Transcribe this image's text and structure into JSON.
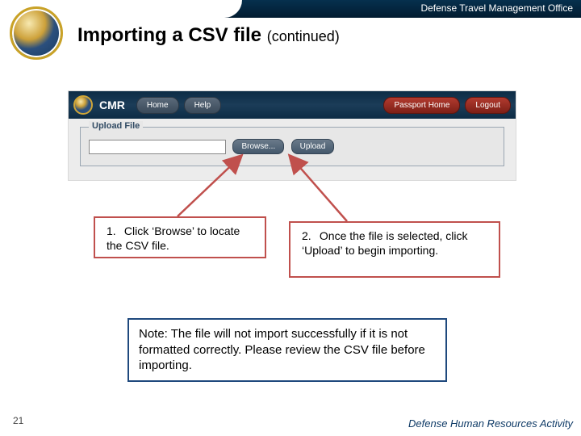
{
  "header": {
    "org": "Defense Travel Management Office",
    "title": "Importing a CSV file",
    "subtitle": "(continued)"
  },
  "screenshot": {
    "app_label": "CMR",
    "nav": {
      "home": "Home",
      "help": "Help",
      "passport": "Passport Home",
      "logout": "Logout"
    },
    "fieldset_legend": "Upload File",
    "browse_btn": "Browse...",
    "upload_btn": "Upload"
  },
  "callouts": {
    "step1_num": "1.",
    "step1_text": "Click ‘Browse’ to locate the CSV file.",
    "step2_num": "2.",
    "step2_text": "Once the file is selected, click ‘Upload’ to begin importing."
  },
  "note": "Note: The file will not import successfully if it is not formatted correctly. Please review the CSV file before importing.",
  "footer": {
    "page": "21",
    "right": "Defense Human Resources Activity"
  }
}
